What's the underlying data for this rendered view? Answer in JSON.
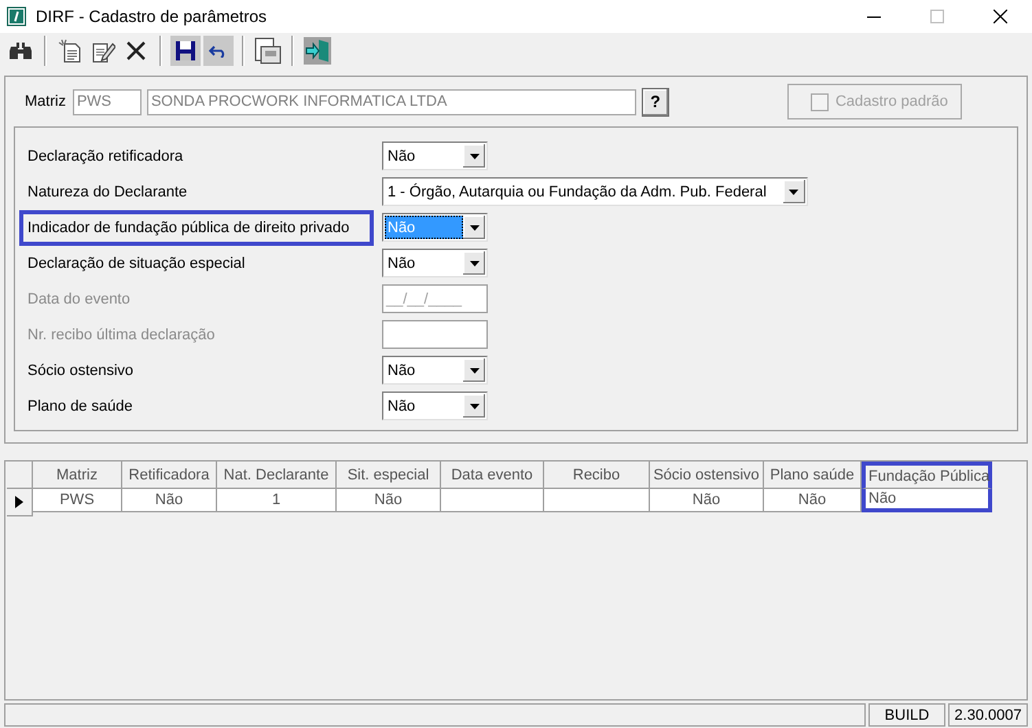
{
  "window": {
    "title": "DIRF - Cadastro de parâmetros"
  },
  "toolbar": [
    {
      "kind": "search",
      "pressed": false
    },
    {
      "kind": "separator"
    },
    {
      "kind": "new",
      "pressed": false
    },
    {
      "kind": "edit",
      "pressed": false
    },
    {
      "kind": "delete",
      "pressed": false
    },
    {
      "kind": "separator"
    },
    {
      "kind": "save",
      "pressed": true
    },
    {
      "kind": "undo",
      "pressed": true
    },
    {
      "kind": "separator"
    },
    {
      "kind": "preview",
      "pressed": false
    },
    {
      "kind": "separator"
    },
    {
      "kind": "exit",
      "pressed": false
    }
  ],
  "header": {
    "matriz_label": "Matriz",
    "matriz_code": "PWS",
    "matriz_name": "SONDA PROCWORK INFORMATICA LTDA",
    "lookup_button": "?",
    "default_checkbox": {
      "label": "Cadastro padrão",
      "checked": false,
      "disabled": true
    }
  },
  "form": {
    "fields": [
      {
        "kind": "select",
        "label": "Declaração retificadora",
        "value": "Não",
        "disabled": false,
        "focused": false,
        "highlighted": false
      },
      {
        "kind": "select",
        "label": "Natureza do Declarante",
        "value": "1 - Órgão, Autarquia ou Fundação da Adm. Pub. Federal",
        "disabled": false,
        "focused": false,
        "highlighted": false
      },
      {
        "kind": "select",
        "label": "Indicador de fundação pública de direito privado",
        "value": "Não",
        "disabled": false,
        "focused": true,
        "highlighted": true
      },
      {
        "kind": "select",
        "label": "Declaração de situação especial",
        "value": "Não",
        "disabled": false,
        "focused": false,
        "highlighted": false
      },
      {
        "kind": "text",
        "label": "Data do evento",
        "value": "__/__/____",
        "disabled": true,
        "highlighted": false
      },
      {
        "kind": "text",
        "label": "Nr. recibo última declaração",
        "disabled": true,
        "highlighted": false
      },
      {
        "kind": "select",
        "label": "Sócio ostensivo",
        "value": "Não",
        "disabled": false,
        "focused": false,
        "highlighted": false
      },
      {
        "kind": "select",
        "label": "Plano de saúde",
        "value": "Não",
        "disabled": false,
        "focused": false,
        "highlighted": false
      }
    ]
  },
  "table": {
    "columns": [
      {
        "title": "Matriz",
        "highlighted": false
      },
      {
        "title": "Retificadora",
        "highlighted": false
      },
      {
        "title": "Nat. Declarante",
        "highlighted": false
      },
      {
        "title": "Sit. especial",
        "highlighted": false
      },
      {
        "title": "Data evento",
        "highlighted": false
      },
      {
        "title": "Recibo",
        "highlighted": false
      },
      {
        "title": "Sócio ostensivo",
        "highlighted": false
      },
      {
        "title": "Plano saúde",
        "highlighted": false
      },
      {
        "title": "Fundação Pública",
        "highlighted": true
      }
    ],
    "rows": [
      {
        "selected": true,
        "cells": [
          "PWS",
          "Não",
          "1",
          "Não",
          "",
          "",
          "Não",
          "Não",
          "Não"
        ]
      }
    ]
  },
  "status_bar": {
    "panel_2": "BUILD",
    "version": "2.30.0007"
  }
}
